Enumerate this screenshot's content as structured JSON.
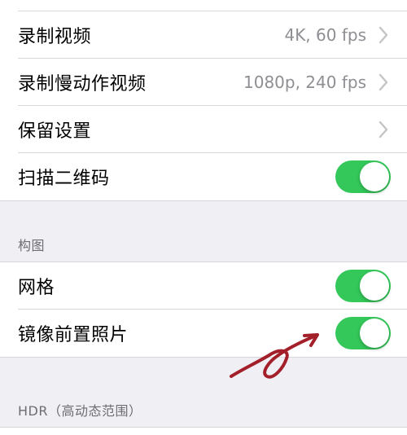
{
  "camera_settings": {
    "rows": [
      {
        "label": "录制视频",
        "value": "4K, 60 fps"
      },
      {
        "label": "录制慢动作视频",
        "value": "1080p, 240 fps"
      },
      {
        "label": "保留设置",
        "value": ""
      },
      {
        "label": "扫描二维码",
        "toggle": "on"
      }
    ]
  },
  "composition": {
    "header": "构图",
    "rows": [
      {
        "label": "网格",
        "toggle": "on"
      },
      {
        "label": "镜像前置照片",
        "toggle": "on"
      }
    ]
  },
  "hdr": {
    "header": "HDR（高动态范围）"
  },
  "colors": {
    "toggle_on": "#34c759",
    "annotation": "#a3202a"
  },
  "icons": {
    "chevron": "chevron-right-icon",
    "annotation": "red-arrow-annotation"
  }
}
